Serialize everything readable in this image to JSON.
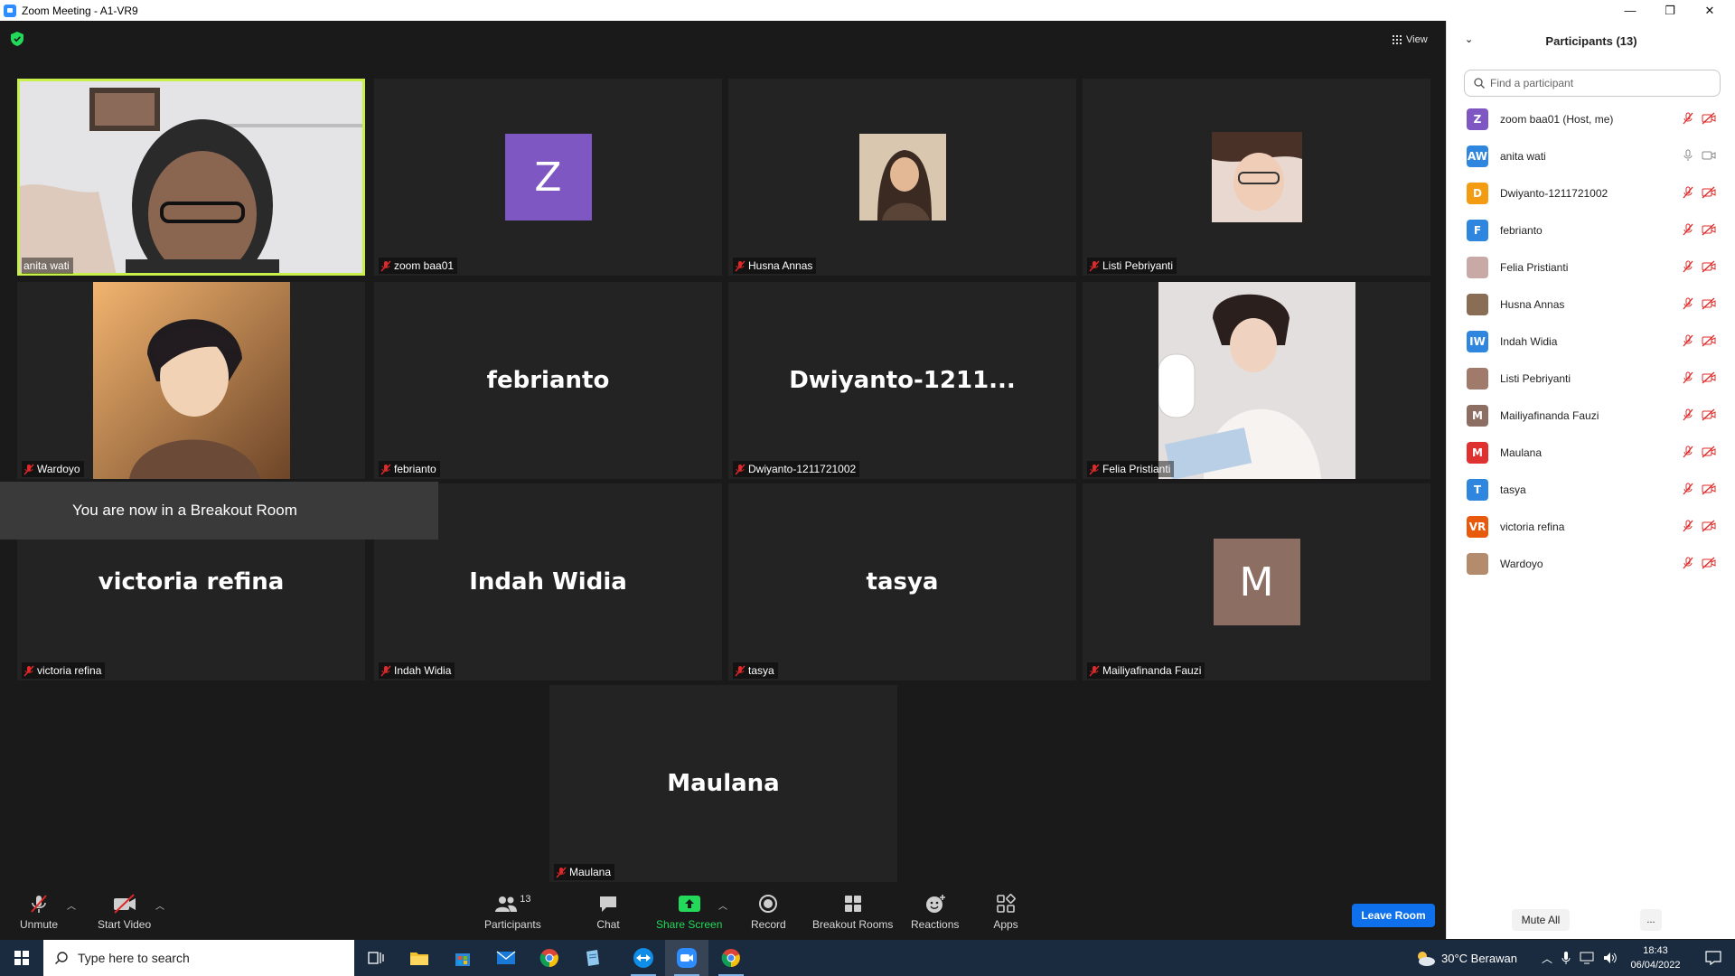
{
  "window": {
    "title": "Zoom Meeting - A1-VR9",
    "minimize": "—",
    "restore": "❐",
    "close": "✕"
  },
  "meeting": {
    "view_label": "View",
    "breakout_notice": "You are now in a Breakout Room",
    "active_speaker_color": "#c8f04b",
    "tiles": [
      {
        "label": "anita wati",
        "big_name": "",
        "muted": false
      },
      {
        "label": "zoom baa01",
        "big_name": "",
        "avatar_letter": "Z",
        "avatar_color": "#7e57c2",
        "muted": true
      },
      {
        "label": "Husna Annas",
        "big_name": "",
        "muted": true
      },
      {
        "label": "Listi Pebriyanti",
        "big_name": "",
        "muted": true
      },
      {
        "label": "Wardoyo",
        "big_name": "",
        "muted": true
      },
      {
        "label": "febrianto",
        "big_name": "febrianto",
        "muted": true
      },
      {
        "label": "Dwiyanto-1211721002",
        "big_name": "Dwiyanto-1211...",
        "muted": true
      },
      {
        "label": "Felia Pristianti",
        "big_name": "",
        "muted": true
      },
      {
        "label": "victoria refina",
        "big_name": "victoria refina",
        "muted": true
      },
      {
        "label": "Indah Widia",
        "big_name": "Indah Widia",
        "muted": true
      },
      {
        "label": "tasya",
        "big_name": "tasya",
        "muted": true
      },
      {
        "label": "Mailiyafinanda Fauzi",
        "big_name": "",
        "avatar_letter": "M",
        "avatar_color": "#8d6e63",
        "muted": true
      },
      {
        "label": "Maulana",
        "big_name": "Maulana",
        "muted": true
      }
    ]
  },
  "toolbar": {
    "unmute": "Unmute",
    "start_video": "Start Video",
    "participants": "Participants",
    "participants_count": "13",
    "chat": "Chat",
    "share_screen": "Share Screen",
    "record": "Record",
    "breakout_rooms": "Breakout Rooms",
    "reactions": "Reactions",
    "apps": "Apps",
    "leave_room": "Leave Room",
    "share_color": "#23d959",
    "leave_color": "#0e71eb"
  },
  "panel": {
    "title": "Participants (13)",
    "search_placeholder": "Find a participant",
    "mute_all": "Mute All",
    "more": "...",
    "participants": [
      {
        "name": "zoom baa01 (Host, me)",
        "initials": "Z",
        "color": "#7e57c2",
        "muted": true,
        "video_off": true
      },
      {
        "name": "anita wati",
        "initials": "AW",
        "color": "#2e86de",
        "muted": false,
        "video_off": false
      },
      {
        "name": "Dwiyanto-1211721002",
        "initials": "D",
        "color": "#f39c12",
        "muted": true,
        "video_off": true
      },
      {
        "name": "febrianto",
        "initials": "F",
        "color": "#2e86de",
        "muted": true,
        "video_off": true
      },
      {
        "name": "Felia Pristianti",
        "initials": "",
        "color": "#c9a9a6",
        "muted": true,
        "video_off": true
      },
      {
        "name": "Husna Annas",
        "initials": "",
        "color": "#8a6d55",
        "muted": true,
        "video_off": true
      },
      {
        "name": "Indah Widia",
        "initials": "IW",
        "color": "#2e86de",
        "muted": true,
        "video_off": true
      },
      {
        "name": "Listi Pebriyanti",
        "initials": "",
        "color": "#a07a6a",
        "muted": true,
        "video_off": true
      },
      {
        "name": "Mailiyafinanda Fauzi",
        "initials": "M",
        "color": "#8d6e63",
        "muted": true,
        "video_off": true
      },
      {
        "name": "Maulana",
        "initials": "M",
        "color": "#e03131",
        "muted": true,
        "video_off": true
      },
      {
        "name": "tasya",
        "initials": "T",
        "color": "#2e86de",
        "muted": true,
        "video_off": true
      },
      {
        "name": "victoria refina",
        "initials": "VR",
        "color": "#e8590c",
        "muted": true,
        "video_off": true
      },
      {
        "name": "Wardoyo",
        "initials": "",
        "color": "#b38b6d",
        "muted": true,
        "video_off": true
      }
    ]
  },
  "taskbar": {
    "search_placeholder": "Type here to search",
    "weather": "30°C  Berawan",
    "time": "18:43",
    "date": "06/04/2022"
  }
}
